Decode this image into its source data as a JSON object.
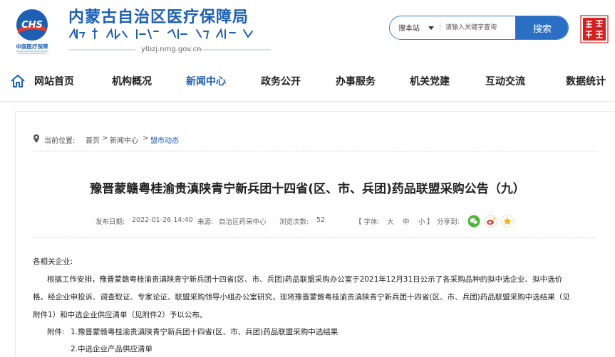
{
  "header": {
    "site_title": "内蒙古自治区医疗保障局",
    "url": "ylbzj.nmg.gov.cn",
    "logo_caption": "中国医疗保障",
    "logo_text": "CHS"
  },
  "search": {
    "scope": "搜本站",
    "placeholder": "请输入关键字查询",
    "button": "搜索"
  },
  "nav": {
    "items": [
      {
        "label": "网站首页"
      },
      {
        "label": "机构概况"
      },
      {
        "label": "新闻中心"
      },
      {
        "label": "政务公开"
      },
      {
        "label": "办事服务"
      },
      {
        "label": "机关党建"
      },
      {
        "label": "互动交流"
      },
      {
        "label": "数据统计"
      }
    ],
    "active": "新闻中心"
  },
  "breadcrumb": {
    "prefix": "当前位置:",
    "home": "首页",
    "sep": ">",
    "level1": "新闻中心",
    "current": "盟市动态"
  },
  "article": {
    "title": "豫晋蒙赣粤桂渝贵滇陕青宁新兵团十四省(区、市、兵团)药品联盟采购公告（九）",
    "date_label": "发布日期:",
    "date": "2022-01-26 14:40",
    "source_label": "来源:",
    "source": "自治区药采中心",
    "views_label": "浏览次数:",
    "views": "52",
    "font_label": "【 字体:",
    "font_large": "大",
    "font_medium": "中",
    "font_small": "小",
    "font_close": "】",
    "share_label": "分享到:",
    "greeting": "各相关企业:",
    "para1_line1": "根据工作安排，豫晋蒙赣粤桂渝贵滇陕青宁新兵团十四省(区、市、兵团)药品联盟采购办公室于2021年12月31日公示了各采购品种的拟中选企业、拟中选价",
    "para1_line2": "格。经企业申投诉、调查取证、专家论证、联盟采购领导小组办公室研究，现将豫晋蒙赣粤桂渝贵滇陕青宁新兵团十四省(区、市、兵团)药品联盟采购中选结果（见",
    "para1_line3": "附件1）和中选企业供应清单（见附件2）予以公布。",
    "attach_label": "附件:",
    "attach1": "1.豫晋蒙赣粤桂渝贵滇陕青宁新兵团十四省(区、市、兵团)药品联盟采购中选结果",
    "attach2": "2.中选企业产品供应清单"
  },
  "colors": {
    "brand_blue": "#1e5fb4",
    "button_blue": "#2b6fc4",
    "seal_red": "#d42020",
    "wechat_green": "#4fb53b",
    "weibo_red": "#e6463c",
    "qzone_yellow": "#f2b31b"
  },
  "icons": {
    "home": "home-icon",
    "pin": "location-pin-icon",
    "dropdown": "caret-down-icon",
    "share": [
      "wechat-icon",
      "weibo-icon",
      "qzone-icon"
    ]
  }
}
